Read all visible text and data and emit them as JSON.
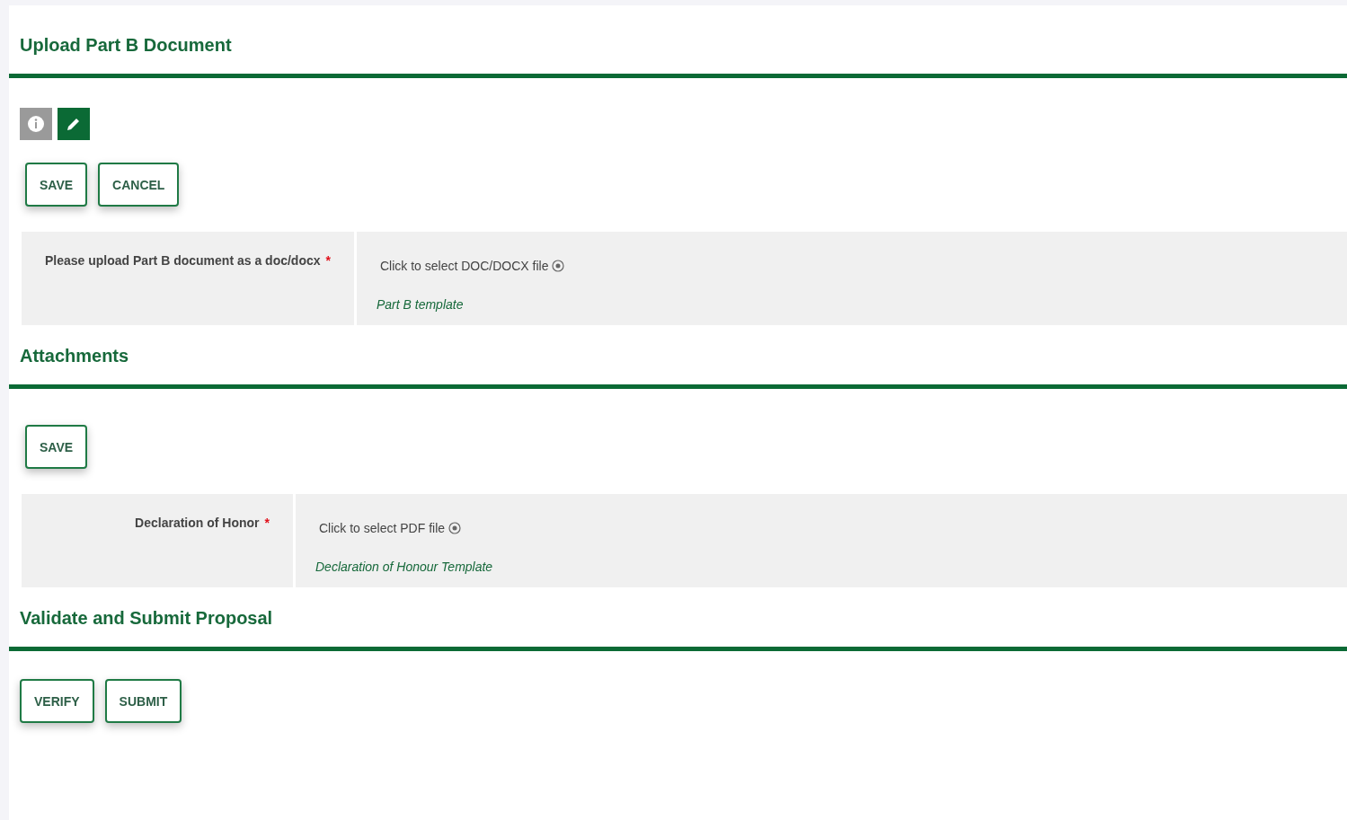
{
  "sections": [
    {
      "title": "Upload Part B Document",
      "tools": [
        {
          "kind": "info",
          "selected": false
        },
        {
          "kind": "edit",
          "selected": true
        }
      ],
      "buttons": [
        "SAVE",
        "CANCEL"
      ],
      "fields": [
        {
          "label": "Please upload Part B document as a doc/docx",
          "required": true,
          "required_mark": "*",
          "upload_text": "Click to select DOC/DOCX file",
          "template_link": "Part B template"
        }
      ]
    },
    {
      "title": "Attachments",
      "buttons": [
        "SAVE"
      ],
      "fields": [
        {
          "label": "Declaration of Honor",
          "required": true,
          "required_mark": "*",
          "upload_text": "Click to select PDF file",
          "template_link": "Declaration of Honour Template"
        }
      ]
    },
    {
      "title": "Validate and Submit Proposal",
      "buttons": [
        "VERIFY",
        "SUBMIT"
      ]
    }
  ]
}
